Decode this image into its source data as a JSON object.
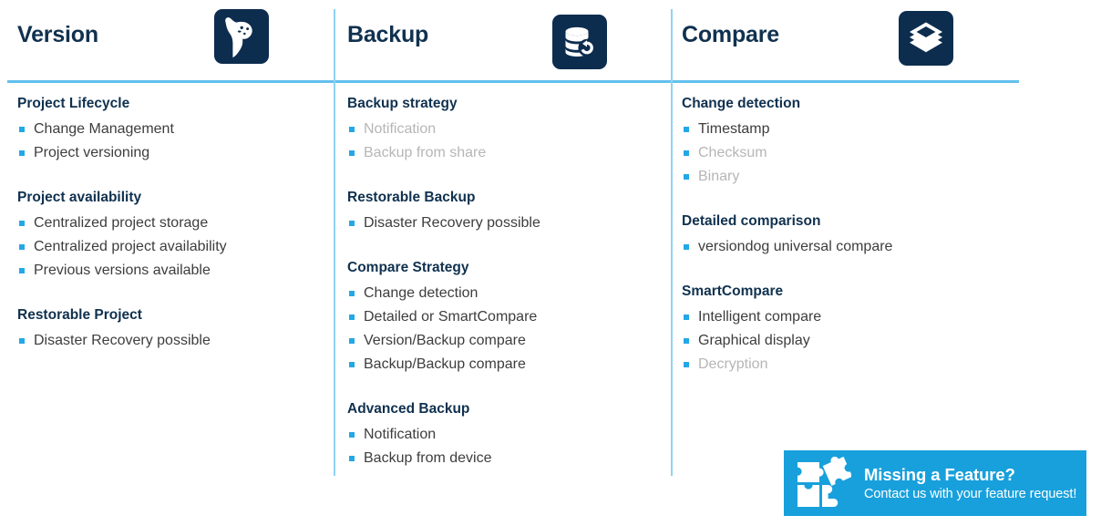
{
  "theme": {
    "navy": "#0D2D4E",
    "accent_blue": "#23A8E6",
    "divider_blue": "#8ED2F4",
    "rule_blue": "#63C0EE",
    "badge_blue": "#18A0DC",
    "text_gray": "#3D3D3D",
    "text_dim": "#B6B6B6",
    "background": "#FFFFFF"
  },
  "columns": [
    {
      "title": "Version",
      "icon": "versiondog-dog-icon",
      "groups": [
        {
          "title": "Project Lifecycle",
          "items": [
            {
              "label": "Change Management",
              "dim": false
            },
            {
              "label": "Project versioning",
              "dim": false
            }
          ]
        },
        {
          "title": "Project availability",
          "items": [
            {
              "label": "Centralized project storage",
              "dim": false
            },
            {
              "label": "Centralized project availability",
              "dim": false
            },
            {
              "label": "Previous versions available",
              "dim": false
            }
          ]
        },
        {
          "title": "Restorable Project",
          "items": [
            {
              "label": "Disaster Recovery possible",
              "dim": false
            }
          ]
        }
      ]
    },
    {
      "title": "Backup",
      "icon": "database-restore-icon",
      "groups": [
        {
          "title": "Backup strategy",
          "items": [
            {
              "label": "Notification",
              "dim": true
            },
            {
              "label": "Backup from share",
              "dim": true
            }
          ]
        },
        {
          "title": "Restorable Backup",
          "items": [
            {
              "label": "Disaster Recovery possible",
              "dim": false
            }
          ]
        },
        {
          "title": "Compare Strategy",
          "items": [
            {
              "label": "Change detection",
              "dim": false
            },
            {
              "label": "Detailed or SmartCompare",
              "dim": false
            },
            {
              "label": "Version/Backup compare",
              "dim": false
            },
            {
              "label": "Backup/Backup compare",
              "dim": false
            }
          ]
        },
        {
          "title": "Advanced Backup",
          "items": [
            {
              "label": "Notification",
              "dim": false
            },
            {
              "label": "Backup from device",
              "dim": false
            }
          ]
        }
      ]
    },
    {
      "title": "Compare",
      "icon": "layers-stack-icon",
      "groups": [
        {
          "title": "Change detection",
          "items": [
            {
              "label": "Timestamp",
              "dim": false
            },
            {
              "label": "Checksum",
              "dim": true
            },
            {
              "label": "Binary",
              "dim": true
            }
          ]
        },
        {
          "title": "Detailed comparison",
          "items": [
            {
              "label": "versiondog universal compare",
              "dim": false
            }
          ]
        },
        {
          "title": "SmartCompare",
          "items": [
            {
              "label": "Intelligent compare",
              "dim": false
            },
            {
              "label": "Graphical display",
              "dim": false
            },
            {
              "label": "Decryption",
              "dim": true
            }
          ]
        }
      ]
    }
  ],
  "feature_badge": {
    "icon": "puzzle-pieces-icon",
    "title": "Missing a Feature?",
    "subtitle": "Contact us with your feature request!"
  }
}
